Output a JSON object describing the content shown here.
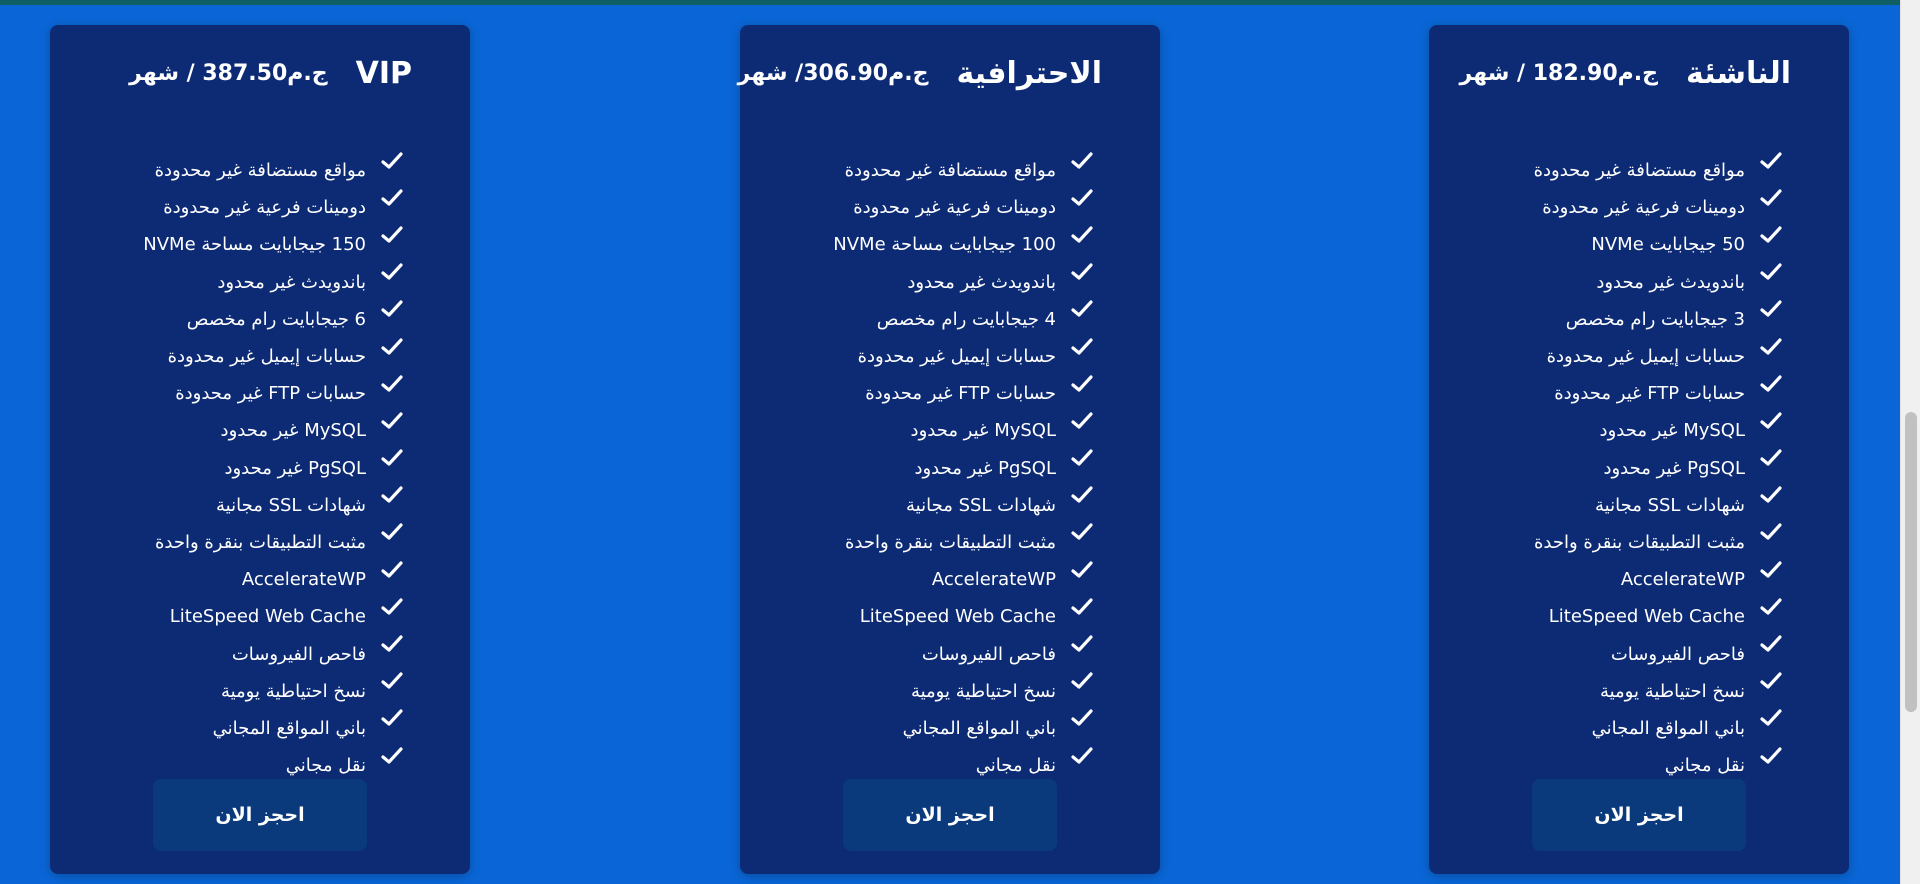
{
  "colors": {
    "page_background": "#0a66d6",
    "card_background": "#0d2b75",
    "button_background": "#0a3a7c",
    "text": "#ffffff"
  },
  "plans": [
    {
      "title": "الناشئة",
      "price": "ج.م182.90 / شهر",
      "features": [
        "مواقع مستضافة غير محدودة",
        "دومينات فرعية غير محدودة",
        "50 جيجابايت NVMe",
        "باندويدث غير محدود",
        "3 جيجابايت رام مخصص",
        "حسابات إيميل غير محدودة",
        "حسابات FTP غير محدودة",
        "MySQL غير محدود",
        "PgSQL غير محدود",
        "شهادات SSL مجانية",
        "مثبت التطبيقات بنقرة واحدة",
        "AccelerateWP",
        "LiteSpeed Web Cache",
        "فاحص الفيروسات",
        "نسخ احتياطية يومية",
        "باني المواقع المجاني",
        "نقل مجاني"
      ],
      "button_label": "احجز الان"
    },
    {
      "title": "الاحترافية",
      "price": "ج.م306.90/ شهر",
      "features": [
        "مواقع مستضافة غير محدودة",
        "دومينات فرعية غير محدودة",
        "100 جيجابايت مساحة NVMe",
        "باندويدث غير محدود",
        "4 جيجابايت رام مخصص",
        "حسابات إيميل غير محدودة",
        "حسابات FTP غير محدودة",
        "MySQL غير محدود",
        "PgSQL غير محدود",
        "شهادات SSL مجانية",
        "مثبت التطبيقات بنقرة واحدة",
        "AccelerateWP",
        "LiteSpeed Web Cache",
        "فاحص الفيروسات",
        "نسخ احتياطية يومية",
        "باني المواقع المجاني",
        "نقل مجاني"
      ],
      "button_label": "احجز الان"
    },
    {
      "title": "VIP",
      "price": "ج.م387.50 / شهر",
      "features": [
        "مواقع مستضافة غير محدودة",
        "دومينات فرعية غير محدودة",
        "150 جيجابايت مساحة NVMe",
        "باندويدث غير محدود",
        "6 جيجابايت رام مخصص",
        "حسابات إيميل غير محدودة",
        "حسابات FTP غير محدودة",
        "MySQL غير محدود",
        "PgSQL غير محدود",
        "شهادات SSL مجانية",
        "مثبت التطبيقات بنقرة واحدة",
        "AccelerateWP",
        "LiteSpeed Web Cache",
        "فاحص الفيروسات",
        "نسخ احتياطية يومية",
        "باني المواقع المجاني",
        "نقل مجاني"
      ],
      "button_label": "احجز الان"
    }
  ],
  "icons": {
    "feature_bullet": "check-icon"
  }
}
